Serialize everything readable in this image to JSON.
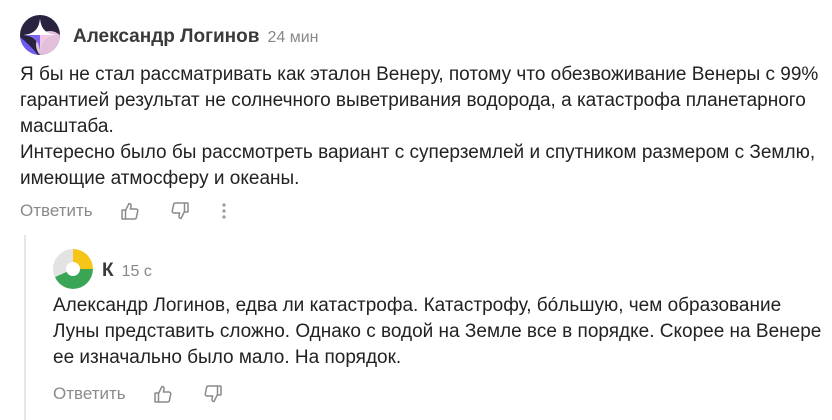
{
  "comments": [
    {
      "author": "Александр Логинов",
      "time": "24 мин",
      "paragraphs": [
        "Я бы не стал рассматривать как эталон Венеру, потому что обезвоживание Венеры с 99% гарантией результат не солнечного выветривания водорода, а катастрофа планетарного масштаба.",
        "Интересно было бы рассмотреть вариант с суперземлей и спутником размером с Землю, имеющие атмосферу и океаны."
      ],
      "reply_label": "Ответить",
      "avatar_icon": "star-avatar-icon"
    },
    {
      "author": "К",
      "time": "15 с",
      "paragraphs": [
        "Александр Логинов, едва ли катастрофа. Катастрофу, бóльшую, чем образование Луны представить сложно. Однако с водой на Земле все в порядке. Скорее на Венере ее изначально было мало. На порядок."
      ],
      "reply_label": "Ответить",
      "avatar_icon": "tricolor-avatar-icon"
    }
  ],
  "colors": {
    "text": "#222222",
    "muted": "#8a8a8a",
    "thread_line": "#e6e6e6",
    "avatar1_bg": "#1a1a2e",
    "avatar1_accent": "#6f5cf5",
    "avatar1_pink": "#f26bd6",
    "avatar2_yellow": "#f5c518",
    "avatar2_green": "#3aa655",
    "avatar2_gray": "#d8d8d8"
  }
}
